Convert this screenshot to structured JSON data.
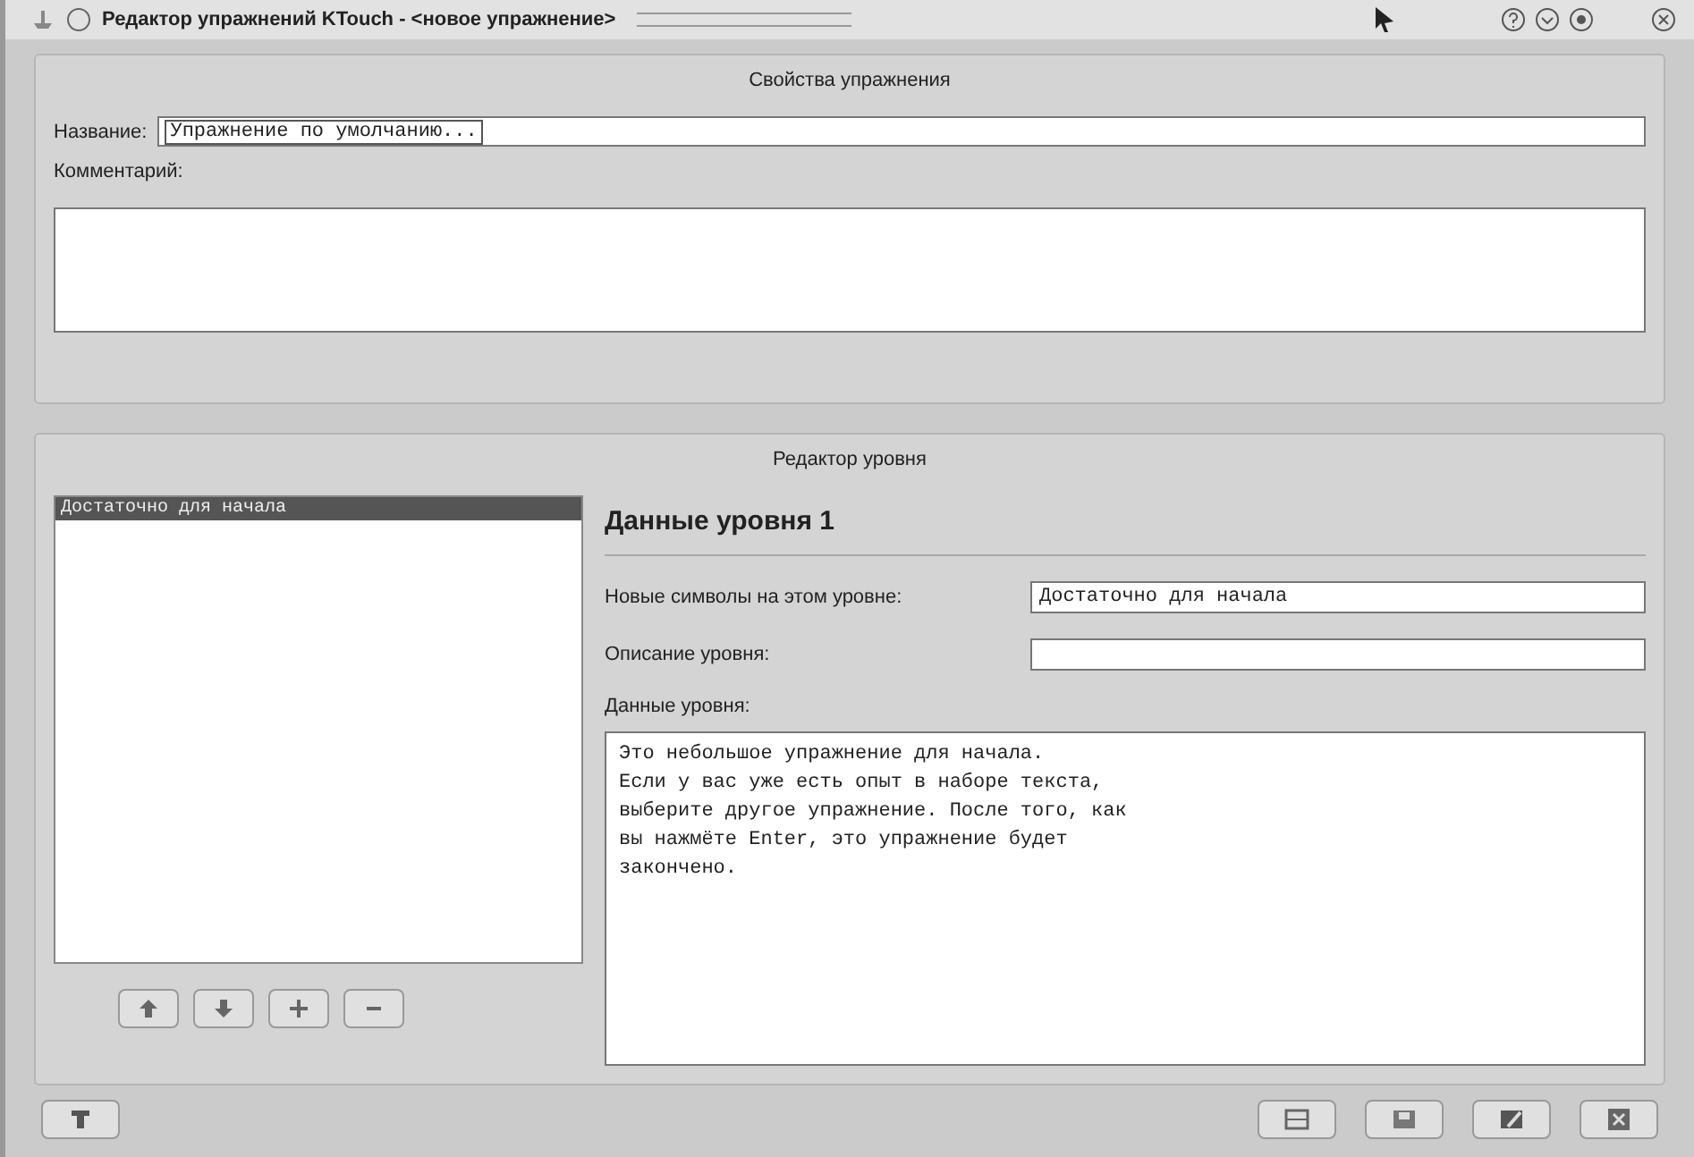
{
  "window": {
    "title": "Редактор упражнений KTouch - <новое упражнение>"
  },
  "properties": {
    "heading": "Свойства упражнения",
    "name_label": "Название:",
    "name_value": "Упражнение по умолчанию...",
    "comment_label": "Комментарий:"
  },
  "level_editor": {
    "heading": "Редактор уровня",
    "levels": [
      {
        "label": "Достаточно для начала",
        "selected": true
      }
    ],
    "level_heading": "Данные уровня 1",
    "new_chars_label": "Новые символы на этом уровне:",
    "new_chars_value": "Достаточно для начала",
    "description_label": "Описание уровня:",
    "data_label": "Данные уровня:",
    "data_lines": [
      "Это небольшое упражнение для начала.",
      "Если у вас уже есть опыт в наборе текста,",
      "выберите другое упражнение. После того, как",
      "вы нажмёте Enter, это упражнение будет",
      "закончено."
    ]
  }
}
